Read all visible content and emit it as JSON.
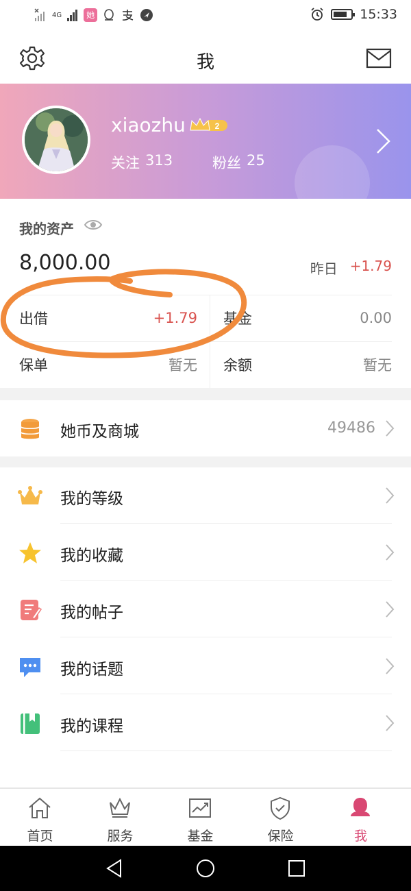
{
  "status_bar": {
    "time": "15:33",
    "network": "4G",
    "app_badge": "她",
    "icons": [
      "no-signal-icon",
      "mobile-signal-icon",
      "app-notification-icon",
      "qq-icon",
      "alipay-icon",
      "location-icon",
      "alarm-icon",
      "battery-icon"
    ],
    "battery_level": 0.8
  },
  "header": {
    "title": "我",
    "icons": [
      "gear-icon",
      "mail-icon"
    ]
  },
  "profile": {
    "username": "xiaozhu",
    "level": "2",
    "follow_label": "关注",
    "follow_count": "313",
    "fans_label": "粉丝",
    "fans_count": "25"
  },
  "assets": {
    "title": "我的资产",
    "total": "8,000.00",
    "yesterday_label": "昨日",
    "yesterday_value": "+1.79",
    "cells": [
      {
        "label": "出借",
        "value": "+1.79"
      },
      {
        "label": "基金",
        "value": "0.00"
      },
      {
        "label": "保单",
        "value": "暂无"
      },
      {
        "label": "余额",
        "value": "暂无"
      }
    ]
  },
  "coins": {
    "label": "她币及商城",
    "value": "49486"
  },
  "menu": [
    {
      "label": "我的等级",
      "icon": "crown-icon"
    },
    {
      "label": "我的收藏",
      "icon": "star-icon"
    },
    {
      "label": "我的帖子",
      "icon": "post-icon"
    },
    {
      "label": "我的话题",
      "icon": "chat-icon"
    },
    {
      "label": "我的课程",
      "icon": "book-icon"
    }
  ],
  "tabs": [
    {
      "label": "首页",
      "icon": "home-icon"
    },
    {
      "label": "服务",
      "icon": "crown-outline-icon"
    },
    {
      "label": "基金",
      "icon": "chart-icon"
    },
    {
      "label": "保险",
      "icon": "shield-icon"
    },
    {
      "label": "我",
      "icon": "person-icon",
      "active": true
    }
  ],
  "colors": {
    "accent": "#d94873",
    "positive": "#d9534f",
    "annotation": "#f08a3c",
    "gradient_start": "#f0a7ba",
    "gradient_end": "#9a94ec"
  }
}
